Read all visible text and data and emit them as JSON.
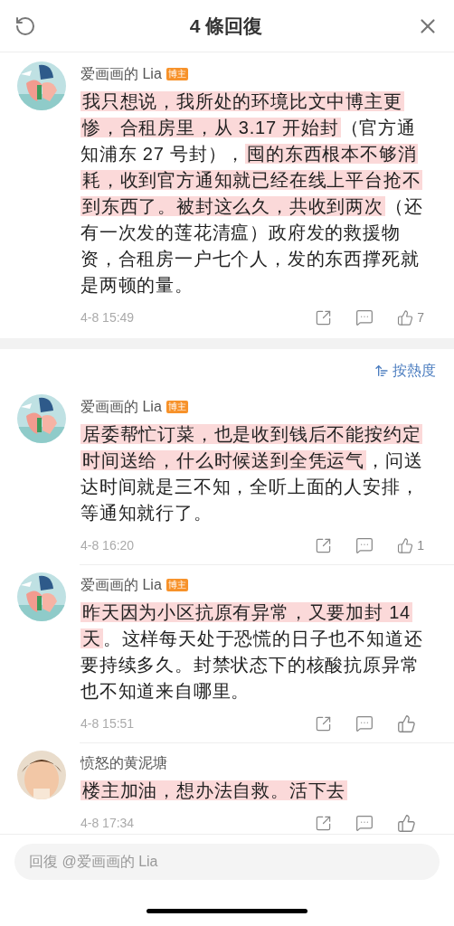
{
  "header": {
    "title": "4 條回復"
  },
  "main_comment": {
    "author": "爱画画的 Lia",
    "badge": "博主",
    "segments": [
      {
        "text": "我只想说，我所处的环境比文中博主更惨，合租房里，从 3.17 开始封",
        "highlighted": true
      },
      {
        "text": "（官方通知浦东 27 号封），",
        "highlighted": false
      },
      {
        "text": "囤的东西根本不够消耗，收到官方通知就已经在线上平台抢不到东西了。被封这么久，共收到两次",
        "highlighted": true
      },
      {
        "text": "（还有一次发的莲花清瘟）政府发的救援物资，合租房一户七个人，发的东西撑死就是两顿的量。",
        "highlighted": false
      }
    ],
    "time": "4-8 15:49",
    "likes": "7"
  },
  "sort": {
    "label": "按熱度"
  },
  "replies": [
    {
      "author": "爱画画的 Lia",
      "badge": "博主",
      "segments": [
        {
          "text": "居委帮忙订菜，也是收到钱后不能按约定时间送给，什么时候送到全凭运气",
          "highlighted": true
        },
        {
          "text": "，问送达时间就是三不知，全听上面的人安排，等通知就行了。",
          "highlighted": false
        }
      ],
      "time": "4-8 16:20",
      "likes": "1"
    },
    {
      "author": "爱画画的 Lia",
      "badge": "博主",
      "segments": [
        {
          "text": "昨天因为小区抗原有异常，又要加封 14 天",
          "highlighted": true
        },
        {
          "text": "。这样每天处于恐慌的日子也不知道还要持续多久。封禁状态下的核酸抗原异常也不知道来自哪里。",
          "highlighted": false
        }
      ],
      "time": "4-8 15:51"
    },
    {
      "author": "愤怒的黄泥塘",
      "segments": [
        {
          "text": "楼主加油，想办法自救。活下去",
          "highlighted": true
        }
      ],
      "time": "4-8 17:34"
    }
  ],
  "reply_field": {
    "placeholder": "回復 @爱画画的 Lia"
  }
}
